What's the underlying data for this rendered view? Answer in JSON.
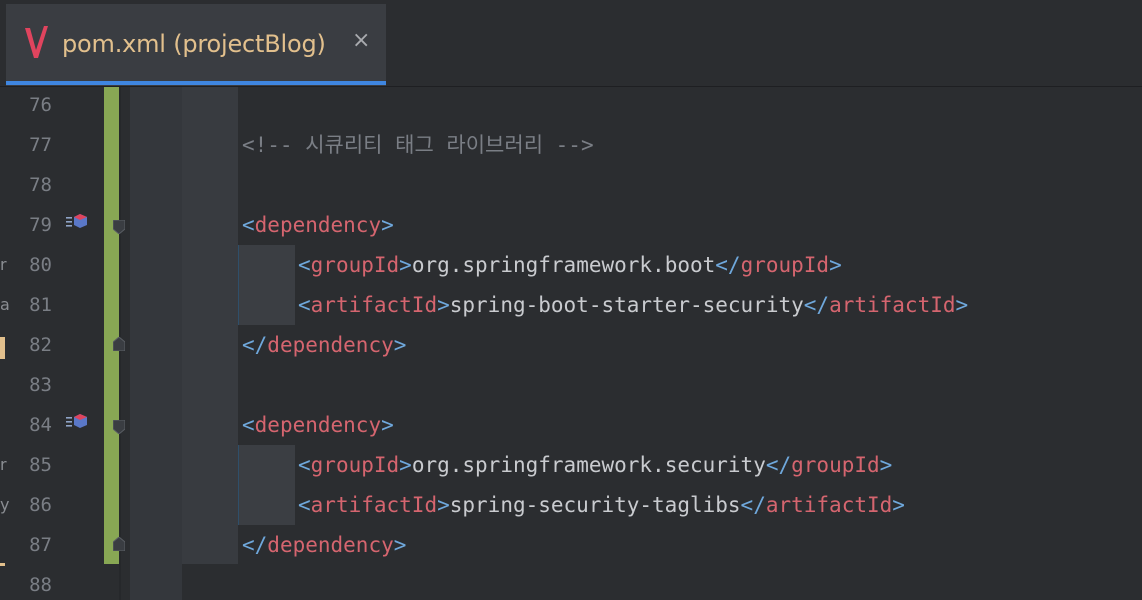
{
  "tab": {
    "title": "pom.xml (projectBlog)",
    "close": "×",
    "icon": "maven-v-icon",
    "title_color": "#e2c08d",
    "active_underline_color": "#3f86e0"
  },
  "editor": {
    "line_numbers": [
      "76",
      "77",
      "78",
      "79",
      "80",
      "81",
      "82",
      "83",
      "84",
      "85",
      "86",
      "87",
      "88"
    ],
    "left_gutter_glyphs": [
      "r",
      "a",
      "r",
      "y"
    ],
    "comment": "<!-- 시큐리티 태그 라이브러리 -->",
    "dependencies": [
      {
        "open_lt": "<",
        "open_tag": "dependency",
        "open_gt": ">",
        "group_lt": "<",
        "group_tag": "groupId",
        "group_gt": ">",
        "group_value": "org.springframework.boot",
        "group_close_lt": "</",
        "group_close_tag": "groupId",
        "group_close_gt": ">",
        "artifact_lt": "<",
        "artifact_tag": "artifactId",
        "artifact_gt": ">",
        "artifact_value": "spring-boot-starter-security",
        "artifact_close_lt": "</",
        "artifact_close_tag": "artifactId",
        "artifact_close_gt": ">",
        "close_lt": "</",
        "close_tag": "dependency",
        "close_gt": ">"
      },
      {
        "open_lt": "<",
        "open_tag": "dependency",
        "open_gt": ">",
        "group_lt": "<",
        "group_tag": "groupId",
        "group_gt": ">",
        "group_value": "org.springframework.security",
        "group_close_lt": "</",
        "group_close_tag": "groupId",
        "group_close_gt": ">",
        "artifact_lt": "<",
        "artifact_tag": "artifactId",
        "artifact_gt": ">",
        "artifact_value": "spring-security-taglibs",
        "artifact_close_lt": "</",
        "artifact_close_tag": "artifactId",
        "artifact_close_gt": ">",
        "close_lt": "</",
        "close_tag": "dependency",
        "close_gt": ">"
      }
    ],
    "colors": {
      "background": "#2b2d30",
      "change_bar": "#88a754",
      "tag": "#d5656f",
      "bracket": "#6fa8dc",
      "comment": "#7a7e85",
      "text": "#c9cbcf"
    }
  }
}
